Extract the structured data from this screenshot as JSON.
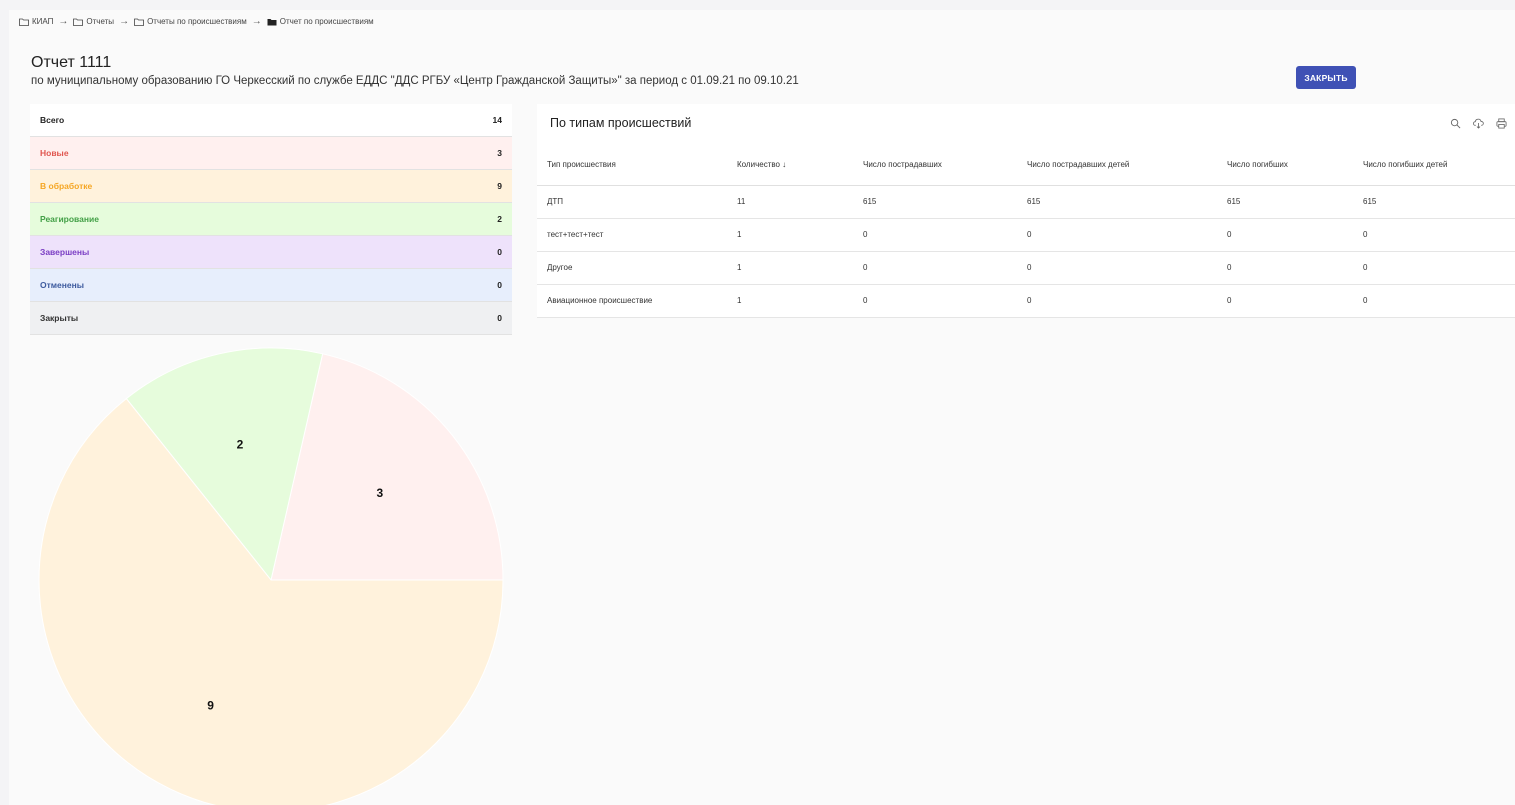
{
  "breadcrumb": [
    "КИАП",
    "Отчеты",
    "Отчеты по происшествиям",
    "Отчет по происшествиям"
  ],
  "header": {
    "title": "Отчет 1111",
    "subtitle": "по муниципальному образованию ГО Черкесский по службе ЕДДС \"ДДС РГБУ «Центр Гражданской Защиты»\" за период с 01.09.21 по 09.10.21",
    "close_label": "ЗАКРЫТЬ"
  },
  "statuses": [
    {
      "label": "Всего",
      "count": "14",
      "bg": "#ffffff",
      "color": "#222222"
    },
    {
      "label": "Новые",
      "count": "3",
      "bg": "#fff0ef",
      "color": "#e0564f"
    },
    {
      "label": "В обработке",
      "count": "9",
      "bg": "#fff2dc",
      "color": "#f5a623"
    },
    {
      "label": "Реагирование",
      "count": "2",
      "bg": "#e6fcdc",
      "color": "#43a047"
    },
    {
      "label": "Завершены",
      "count": "0",
      "bg": "#eee2fb",
      "color": "#7b3fc4"
    },
    {
      "label": "Отменены",
      "count": "0",
      "bg": "#e7eefc",
      "color": "#3d5a9e"
    },
    {
      "label": "Закрыты",
      "count": "0",
      "bg": "#eff0f2",
      "color": "#333333"
    }
  ],
  "incident_table": {
    "title": "По типам происшествий",
    "tools": [
      "search-icon",
      "cloud-download-icon",
      "print-icon"
    ],
    "columns": [
      "Тип происшествия",
      "Количество ↓",
      "Число пострадавших",
      "Число пострадавших детей",
      "Число погибших",
      "Число погибших детей"
    ],
    "rows": [
      [
        "ДТП",
        "11",
        "615",
        "615",
        "615",
        "615"
      ],
      [
        "тест+тест+тест",
        "1",
        "0",
        "0",
        "0",
        "0"
      ],
      [
        "Другое",
        "1",
        "0",
        "0",
        "0",
        "0"
      ],
      [
        "Авиационное происшествие",
        "1",
        "0",
        "0",
        "0",
        "0"
      ]
    ]
  },
  "chart_data": {
    "type": "pie",
    "slices": [
      {
        "label": "Новые",
        "value": 3,
        "color": "#fff0ef"
      },
      {
        "label": "Реагирование",
        "value": 2,
        "color": "#e6fcdc"
      },
      {
        "label": "В обработке",
        "value": 9,
        "color": "#fff2dc"
      }
    ]
  }
}
